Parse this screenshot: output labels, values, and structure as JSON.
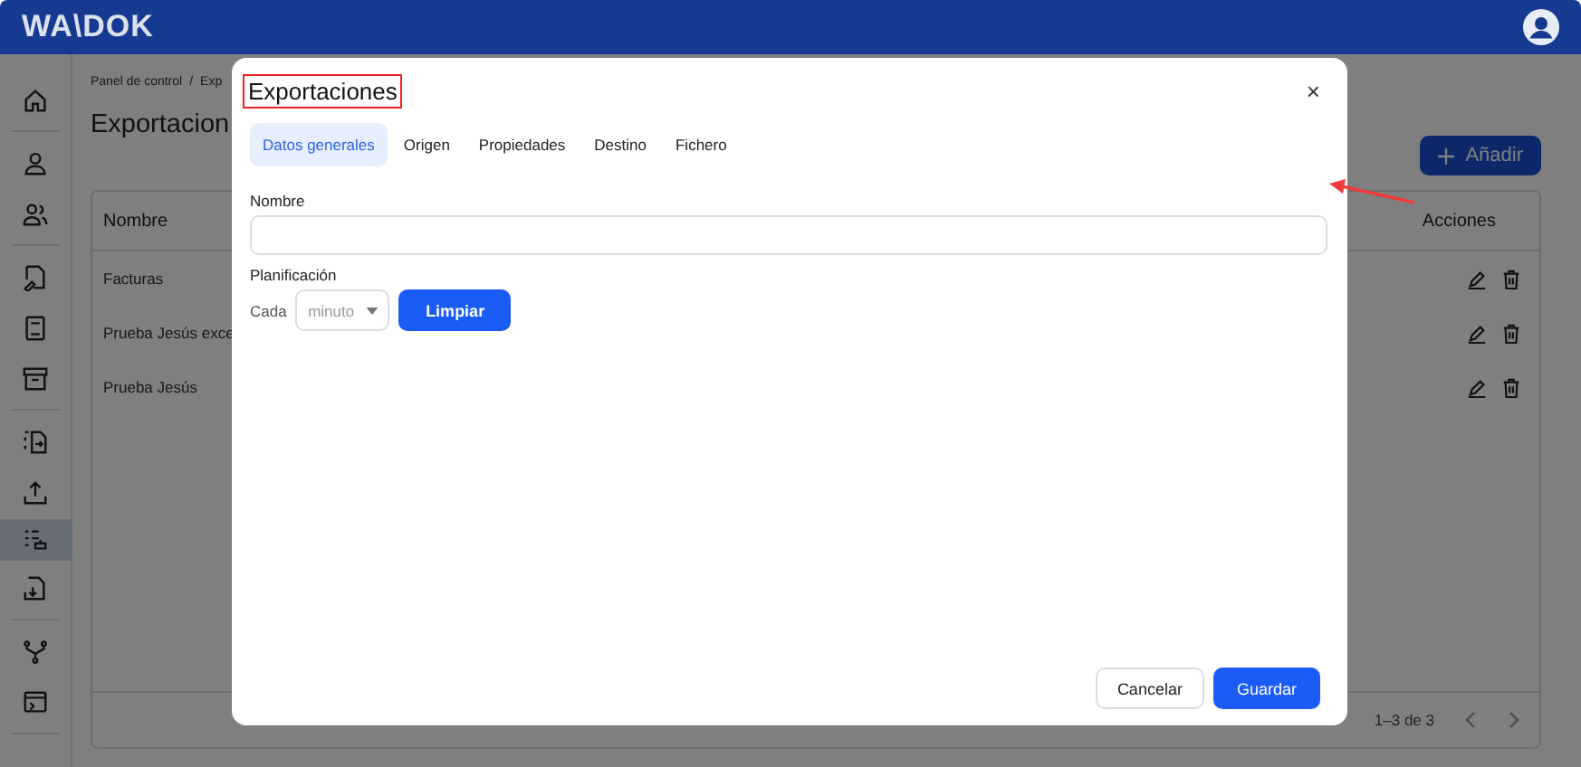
{
  "header": {
    "logo": "WA\\DOK"
  },
  "sidebar": {
    "items": [
      {
        "selected": false
      },
      {
        "selected": false
      },
      {
        "selected": false
      },
      {
        "selected": false
      },
      {
        "selected": false
      },
      {
        "selected": false
      },
      {
        "selected": false
      },
      {
        "selected": false
      },
      {
        "selected": true
      },
      {
        "selected": false
      },
      {
        "selected": false
      },
      {
        "selected": false
      }
    ]
  },
  "page": {
    "breadcrumb": [
      "Panel de control",
      "/",
      "Exp"
    ],
    "title": "Exportacion",
    "add_button": "Añadir",
    "table": {
      "columns": [
        "Nombre",
        "Acciones"
      ],
      "rows": [
        {
          "name": "Facturas"
        },
        {
          "name": "Prueba Jesús exce"
        },
        {
          "name": "Prueba Jesús"
        }
      ],
      "pagination": "1–3 de 3"
    }
  },
  "dialog": {
    "title": "Exportaciones",
    "close": "×",
    "tabs": [
      {
        "label": "Datos generales",
        "selected": true
      },
      {
        "label": "Origen",
        "selected": false
      },
      {
        "label": "Propiedades",
        "selected": false
      },
      {
        "label": "Destino",
        "selected": false
      },
      {
        "label": "Fichero",
        "selected": false
      }
    ],
    "name_label": "Nombre",
    "schedule_label": "Planificación",
    "every_label": "Cada",
    "unit_placeholder": "minuto",
    "clear_button": "Limpiar",
    "buttons": [
      {
        "label": "Cancelar",
        "kind": "secondary"
      },
      {
        "label": "Guardar",
        "kind": "primary"
      }
    ]
  }
}
